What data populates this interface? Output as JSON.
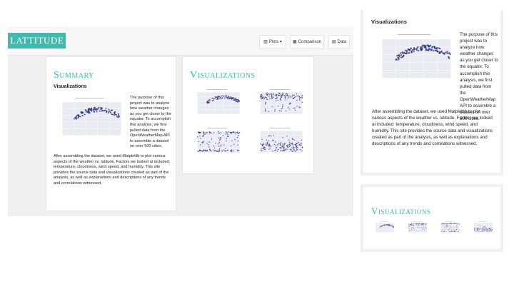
{
  "brand": "LATTITUDE",
  "nav": {
    "plots_label": "Plots",
    "comparison_label": "Comparison",
    "data_label": "Data"
  },
  "summary": {
    "title": "Summary",
    "subtitle": "Visualizations",
    "wrap_text": "The purpose of this project was to analyze how weather changes as you get closer to the equator. To accomplish this analysis, we first pulled data from the OpenWeatherMap API to assemble a dataset on over 500 cities.",
    "para2": "After assembling the dataset, we used Matplotlib to plot various aspects of the weather vs. latitude. Factors we looked at included: temperature, cloudiness, wind speed, and humidity. This site provides the source data and visualizations created as part of the analysis, as well as explanations and descriptions of any trends and correlations witnessed."
  },
  "visualizations": {
    "title": "Visualizations",
    "thumbs": [
      "City Latitude vs. Max Temperature",
      "City Latitude vs. Humidity",
      "City Latitude vs. Cloudiness",
      "City Latitude vs. Wind Speed"
    ]
  },
  "mobile": {
    "subtitle": "Visualizations",
    "vis_title": "Visualizations"
  },
  "colors": {
    "accent": "#3ebbac",
    "marker": "#1f2b7a",
    "plot_bg": "#eaeaf2"
  }
}
